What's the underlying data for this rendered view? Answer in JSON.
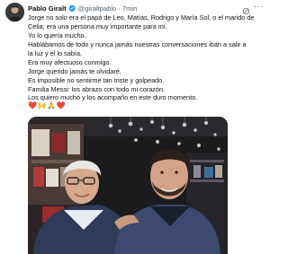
{
  "author": {
    "display_name": "Pablo Giralt",
    "handle": "@giraltpablo",
    "separator": "·",
    "time": "7min",
    "avatar_icon": "profile-avatar",
    "verified_icon": "verified-badge-icon",
    "verified_color": "#1d9bf0"
  },
  "actions": {
    "grok_icon": "grok-icon",
    "more_icon": "more-options-icon",
    "more_glyph": "···"
  },
  "tweet": {
    "lines": [
      "Jorge no solo era el papá de Leo, Matías, Rodrigo y María Sol, o el marido de",
      "Celia; era una persona muy importante para mí.",
      "Yo lo quería mucho.",
      "Hablábamos de todo y nunca jamás nuestras conversaciones iban a salir a",
      "la luz y él lo sabía.",
      "Era muy afectuoso conmigo.",
      "Jorge querido jamás te olvidaré.",
      "Es imposible no sentirme tan triste y golpeado.",
      "Familia Messi: los abrazo con todo mi corazón.",
      "Los quiero mucho y los acompaño en este duro momento."
    ],
    "emojis": [
      "❤️",
      "🙌",
      "🙏",
      "❤️"
    ]
  },
  "media": {
    "type": "photo",
    "description_icon": "attached-photo"
  }
}
